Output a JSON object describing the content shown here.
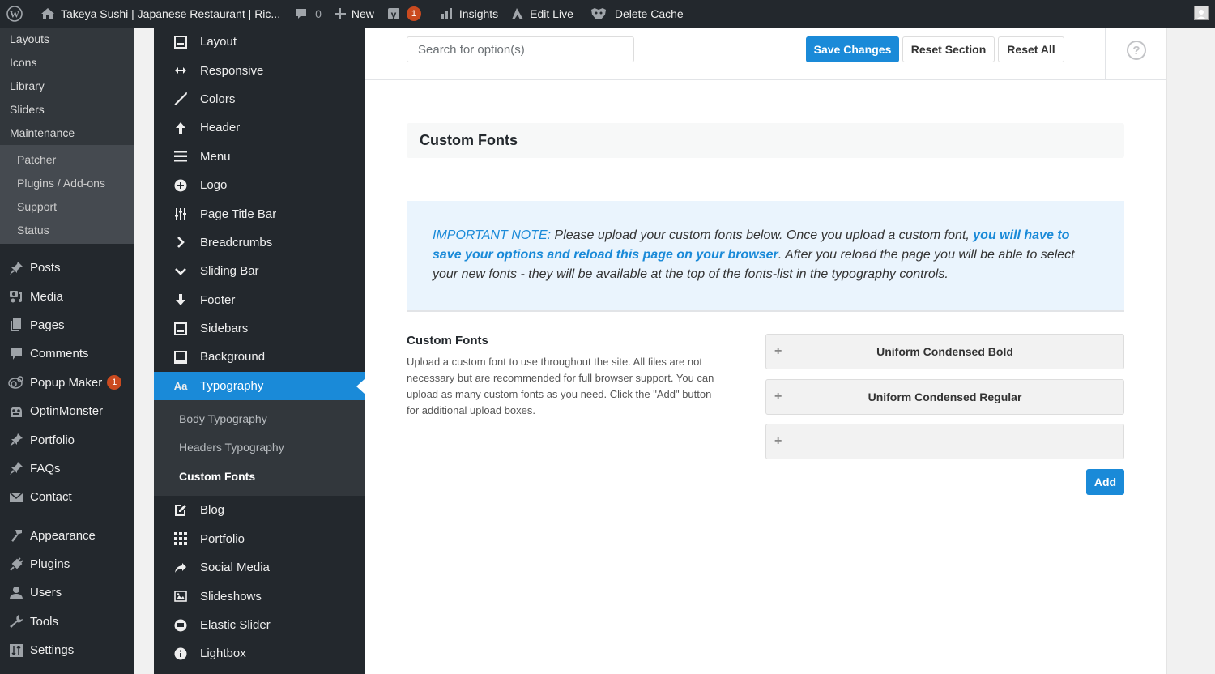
{
  "adminbar": {
    "site_title": "Takeya Sushi | Japanese Restaurant | Ric...",
    "comments_count": "0",
    "new_label": "New",
    "yoast_badge": "1",
    "insights_label": "Insights",
    "edit_live_label": "Edit Live",
    "delete_cache_label": "Delete Cache"
  },
  "wp_menu": {
    "top_sub": [
      "Layouts",
      "Icons",
      "Library",
      "Sliders",
      "Maintenance"
    ],
    "maintenance_sub": [
      "Patcher",
      "Plugins / Add-ons",
      "Support",
      "Status"
    ],
    "main_group1": [
      {
        "label": "Posts",
        "icon": "pin-icon"
      },
      {
        "label": "Media",
        "icon": "media-icon"
      },
      {
        "label": "Pages",
        "icon": "pages-icon"
      },
      {
        "label": "Comments",
        "icon": "comment-icon"
      },
      {
        "label": "Popup Maker",
        "icon": "popup-maker-icon",
        "badge": "1"
      },
      {
        "label": "OptinMonster",
        "icon": "optinmonster-icon"
      },
      {
        "label": "Portfolio",
        "icon": "pin-icon"
      },
      {
        "label": "FAQs",
        "icon": "pin-icon"
      },
      {
        "label": "Contact",
        "icon": "envelope-icon"
      }
    ],
    "main_group2": [
      {
        "label": "Appearance",
        "icon": "brush-icon"
      },
      {
        "label": "Plugins",
        "icon": "plug-icon"
      },
      {
        "label": "Users",
        "icon": "user-icon"
      },
      {
        "label": "Tools",
        "icon": "wrench-icon"
      },
      {
        "label": "Settings",
        "icon": "settings-icon"
      }
    ]
  },
  "options_nav": {
    "items_before": [
      {
        "label": "Layout",
        "icon": "layout-icon"
      },
      {
        "label": "Responsive",
        "icon": "arrows-horizontal-icon"
      },
      {
        "label": "Colors",
        "icon": "brush-stroke-icon"
      },
      {
        "label": "Header",
        "icon": "arrow-up-icon"
      },
      {
        "label": "Menu",
        "icon": "hamburger-icon"
      },
      {
        "label": "Logo",
        "icon": "plus-circle-icon"
      },
      {
        "label": "Page Title Bar",
        "icon": "sliders-icon"
      },
      {
        "label": "Breadcrumbs",
        "icon": "chevron-right-icon"
      },
      {
        "label": "Sliding Bar",
        "icon": "chevron-down-icon"
      },
      {
        "label": "Footer",
        "icon": "arrow-down-icon"
      },
      {
        "label": "Sidebars",
        "icon": "sidebar-icon"
      },
      {
        "label": "Background",
        "icon": "background-icon"
      }
    ],
    "active": {
      "label": "Typography",
      "icon_text": "Aa"
    },
    "sub_items": [
      "Body Typography",
      "Headers Typography",
      "Custom Fonts"
    ],
    "current_sub": "Custom Fonts",
    "items_after": [
      {
        "label": "Blog",
        "icon": "edit-icon"
      },
      {
        "label": "Portfolio",
        "icon": "grid-icon"
      },
      {
        "label": "Social Media",
        "icon": "share-icon"
      },
      {
        "label": "Slideshows",
        "icon": "image-icon"
      },
      {
        "label": "Elastic Slider",
        "icon": "elastic-slider-icon"
      },
      {
        "label": "Lightbox",
        "icon": "info-icon"
      }
    ]
  },
  "toolbar": {
    "search_placeholder": "Search for option(s)",
    "save_label": "Save Changes",
    "reset_section_label": "Reset Section",
    "reset_all_label": "Reset All",
    "help_glyph": "?"
  },
  "section": {
    "title": "Custom Fonts",
    "note": {
      "prefix": "IMPORTANT NOTE:",
      "text1": " Please upload your custom fonts below. Once you upload a custom font, ",
      "bold_link": "you will have to save your options and reload this page on your browser",
      "text2": ". After you reload the page you will be able to select your new fonts - they will be available at the top of the fonts-list in the typography controls."
    },
    "field": {
      "title": "Custom Fonts",
      "description": "Upload a custom font to use throughout the site. All files are not necessary but are recommended for full browser support. You can upload as many custom fonts as you need. Click the \"Add\" button for additional upload boxes."
    },
    "fonts": [
      "Uniform Condensed Bold",
      "Uniform Condensed Regular",
      ""
    ],
    "add_label": "Add"
  },
  "colors": {
    "accent": "#1a8ad8",
    "adminbar": "#23282d",
    "badge": "#ca4a1f",
    "note_bg": "#eaf4fd"
  }
}
